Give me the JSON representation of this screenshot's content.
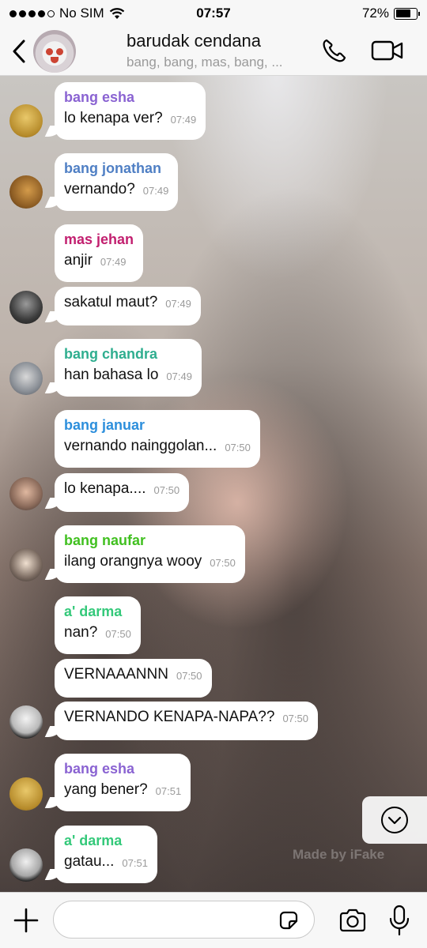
{
  "status_bar": {
    "carrier": "No SIM",
    "time": "07:57",
    "battery_percent": "72%",
    "battery_level": 0.72
  },
  "header": {
    "title": "barudak cendana",
    "subtitle": "bang, bang, mas, bang, ..."
  },
  "messages": [
    {
      "sender": "bang esha",
      "text": "lo kenapa ver?",
      "time": "07:49",
      "sender_color": "#8a63d2"
    },
    {
      "sender": "bang jonathan",
      "text": "vernando?",
      "time": "07:49",
      "sender_color": "#4f7fc4"
    },
    {
      "sender": "mas jehan",
      "text": "anjir",
      "time": "07:49",
      "sender_color": "#c21f6f"
    },
    {
      "sender": "",
      "text": "sakatul maut?",
      "time": "07:49"
    },
    {
      "sender": "bang chandra",
      "text": "han bahasa lo",
      "time": "07:49",
      "sender_color": "#2fae8f"
    },
    {
      "sender": "bang januar",
      "text": "vernando nainggolan...",
      "time": "07:50",
      "sender_color": "#2d8fdc"
    },
    {
      "sender": "",
      "text": "lo kenapa....",
      "time": "07:50"
    },
    {
      "sender": "bang naufar",
      "text": "ilang orangnya wooy",
      "time": "07:50",
      "sender_color": "#41c020"
    },
    {
      "sender": "a' darma",
      "text": "nan?",
      "time": "07:50",
      "sender_color": "#34c97a"
    },
    {
      "sender": "",
      "text": "VERNAAANNN",
      "time": "07:50"
    },
    {
      "sender": "",
      "text": "VERNANDO KENAPA-NAPA??",
      "time": "07:50"
    },
    {
      "sender": "bang esha",
      "text": "yang bener?",
      "time": "07:51",
      "sender_color": "#8a63d2"
    },
    {
      "sender": "a' darma",
      "text": "gatau...",
      "time": "07:51",
      "sender_color": "#34c97a"
    }
  ],
  "watermark": "Made by iFake",
  "input": {
    "placeholder": ""
  },
  "icons": {
    "back": "chevron-left-icon",
    "call": "phone-icon",
    "video": "video-camera-icon",
    "scroll_down": "chevron-down-icon",
    "plus": "plus-icon",
    "sticker": "sticker-icon",
    "camera": "camera-icon",
    "mic": "microphone-icon"
  }
}
